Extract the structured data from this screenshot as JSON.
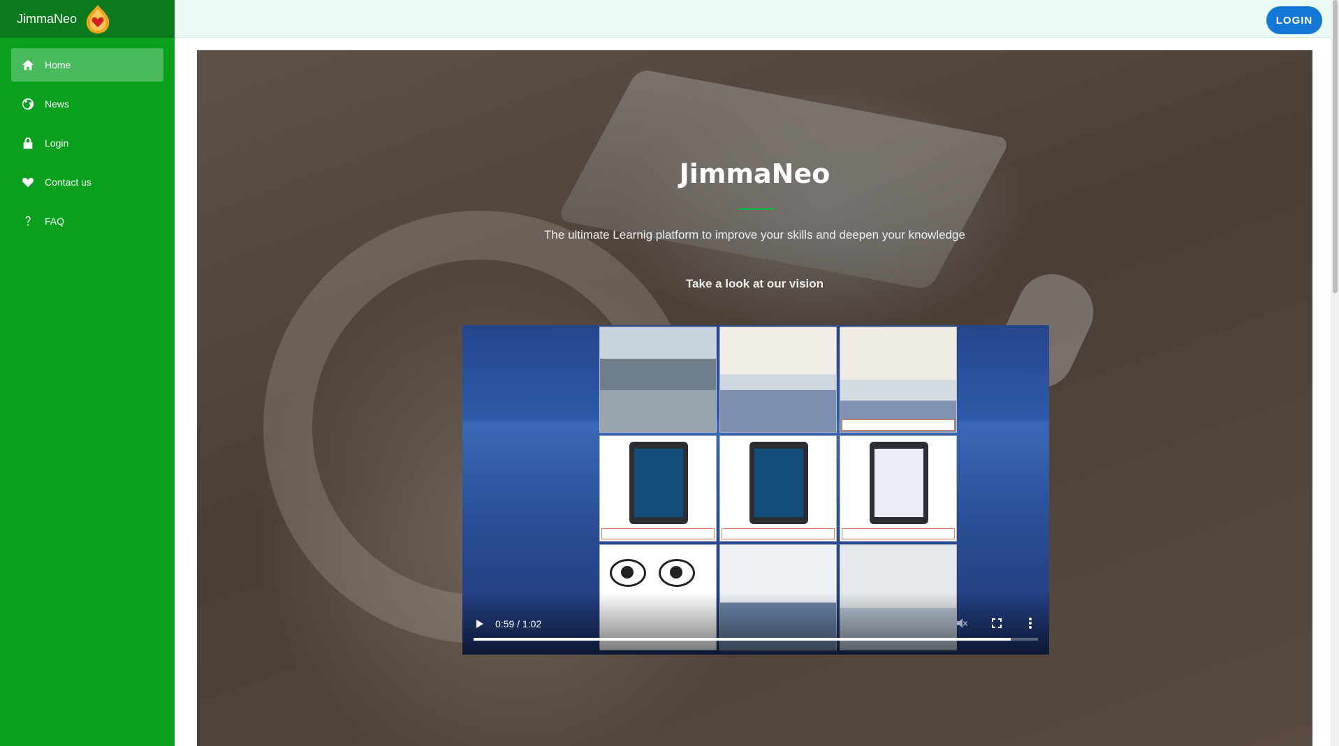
{
  "brand": {
    "name": "JimmaNeo",
    "logo_icon": "flame-heart-icon"
  },
  "sidebar": {
    "items": [
      {
        "label": "Home",
        "icon": "home-icon",
        "active": true
      },
      {
        "label": "News",
        "icon": "globe-icon",
        "active": false
      },
      {
        "label": "Login",
        "icon": "lock-icon",
        "active": false
      },
      {
        "label": "Contact us",
        "icon": "heart-icon",
        "active": false
      },
      {
        "label": "FAQ",
        "icon": "question-icon",
        "active": false
      }
    ]
  },
  "header": {
    "login_label": "LOGIN"
  },
  "hero": {
    "title": "JimmaNeo",
    "subtitle": "The ultimate Learnig platform to improve your skills and deepen your knowledge",
    "vision_heading": "Take a look at our vision"
  },
  "video": {
    "time_display": "0:59 / 1:02",
    "progress_fraction": 0.952,
    "muted": true
  },
  "colors": {
    "sidebar": "#08a01d",
    "brand_bar": "#0b7a1d",
    "active_item": "#47bb5c",
    "topbar": "#e9fbf2",
    "login_button": "#1277d6",
    "accent_underline": "#27a84a"
  }
}
